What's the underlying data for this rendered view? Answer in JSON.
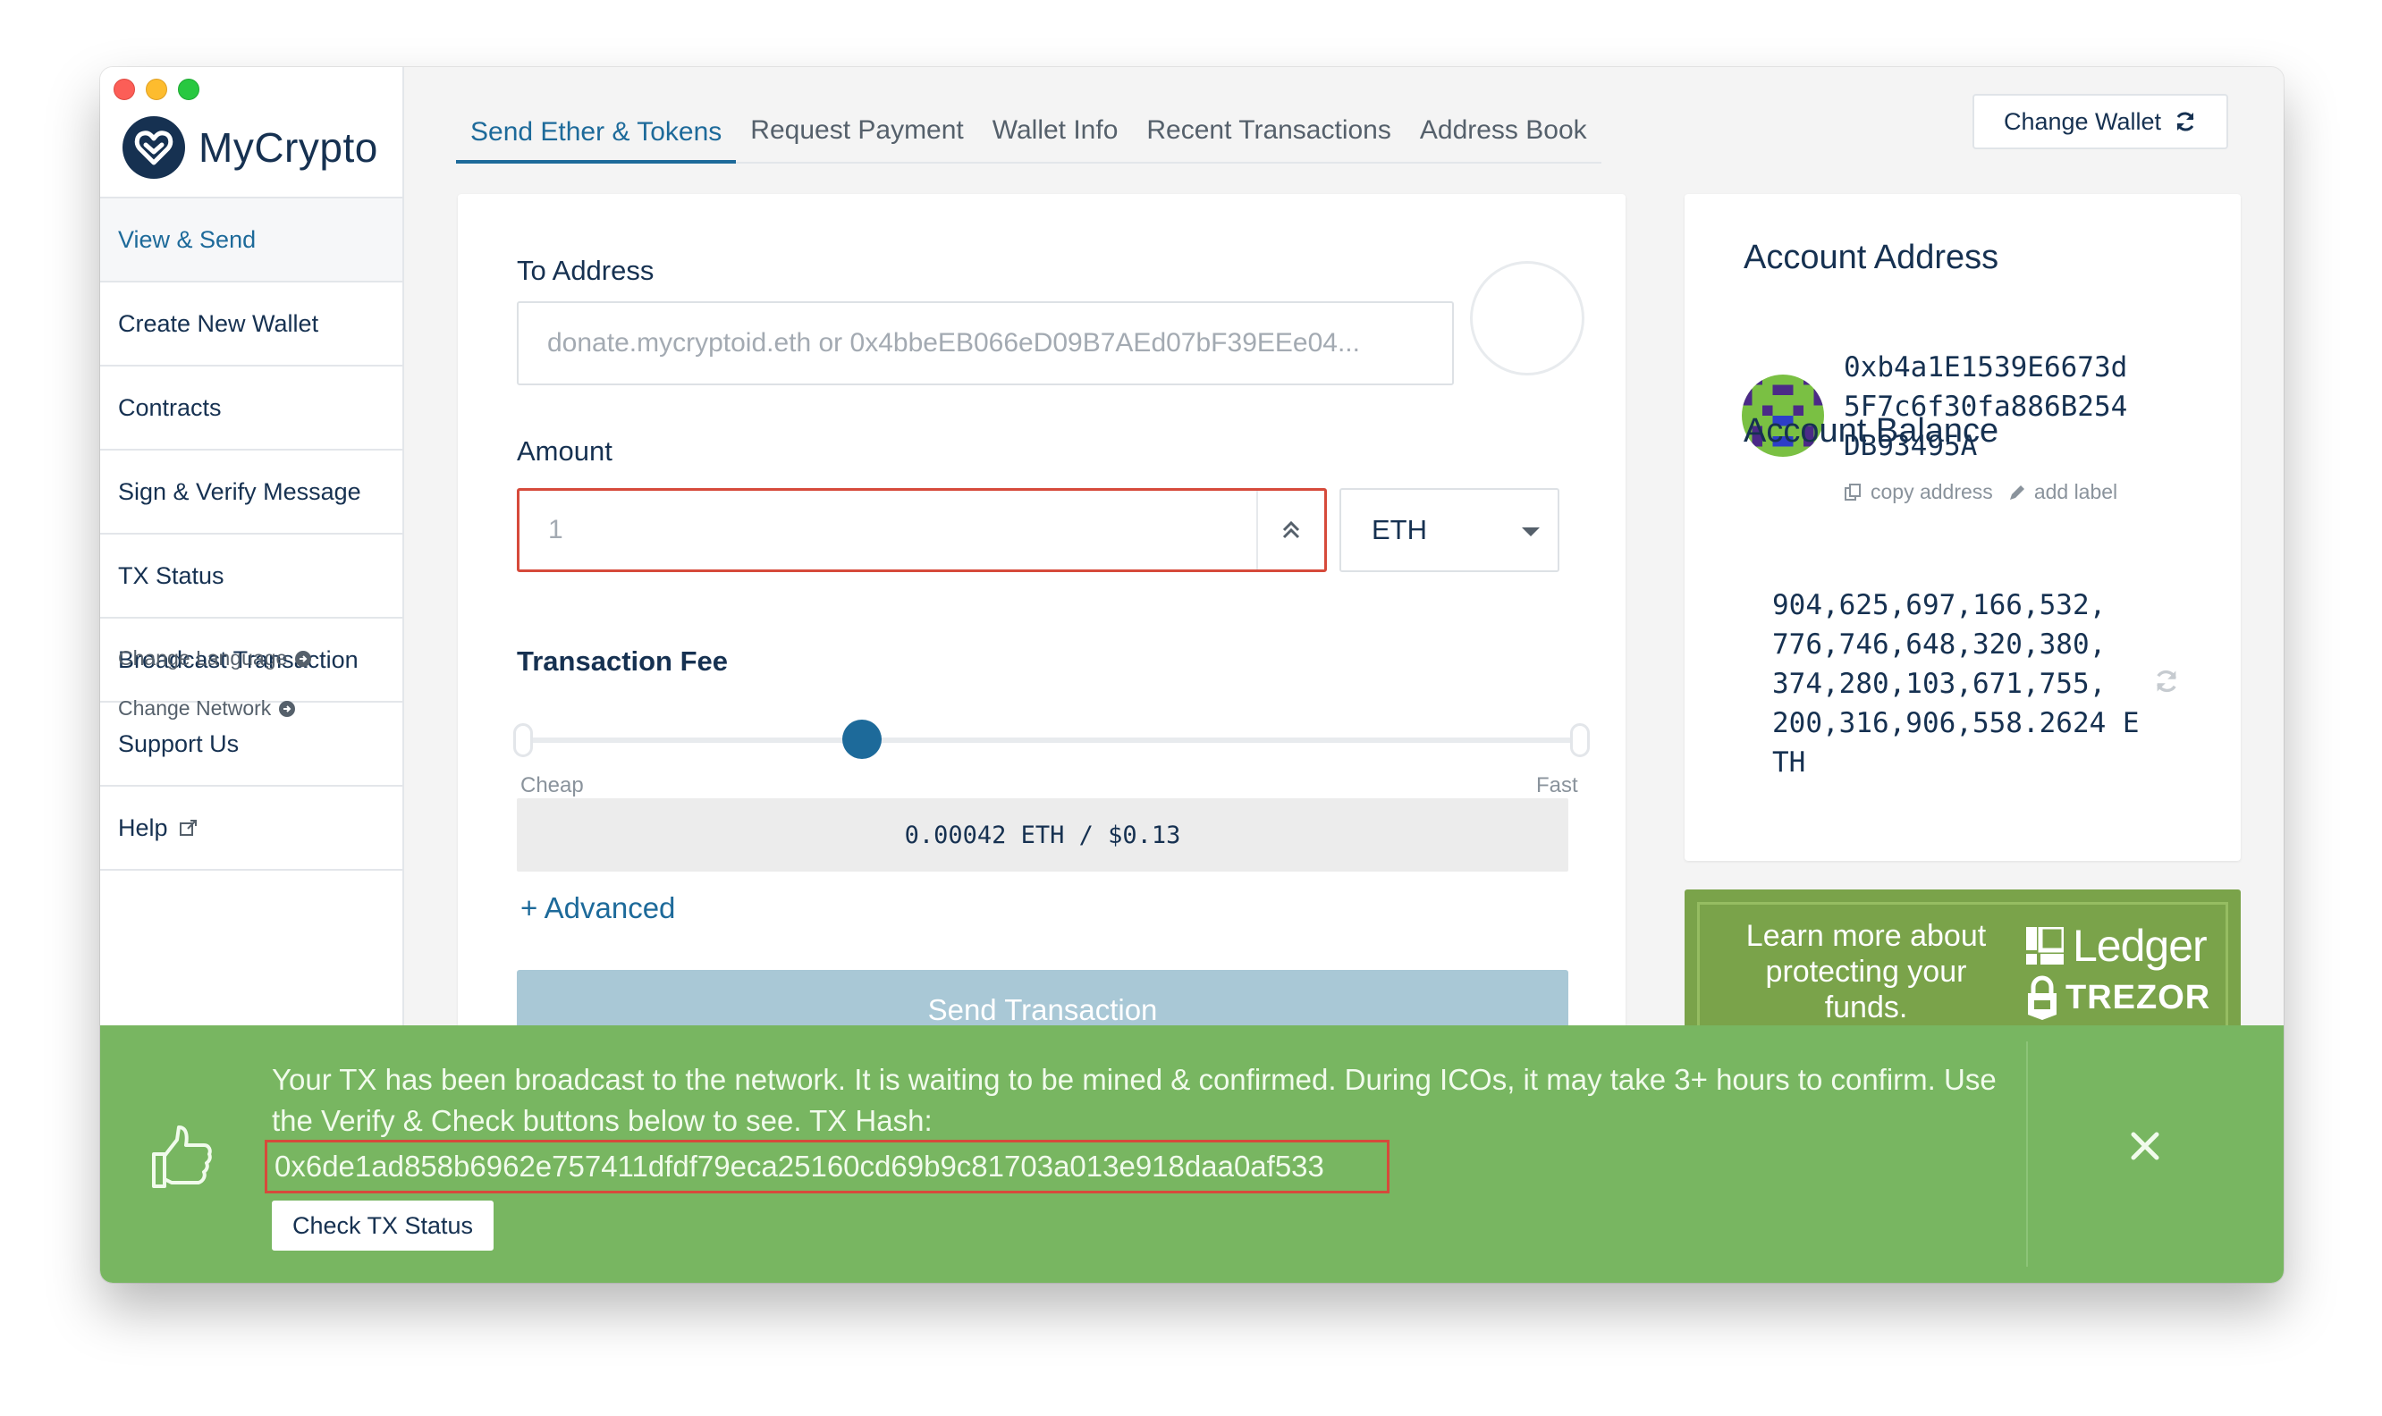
{
  "app": {
    "name": "MyCrypto"
  },
  "sidebar": {
    "items": [
      {
        "label": "View & Send",
        "active": true
      },
      {
        "label": "Create New Wallet"
      },
      {
        "label": "Contracts"
      },
      {
        "label": "Sign & Verify Message"
      },
      {
        "label": "TX Status"
      },
      {
        "label": "Broadcast Transaction"
      },
      {
        "label": "Support Us"
      },
      {
        "label": "Help",
        "icon": "external-link-icon"
      }
    ],
    "change_language": "Change Language",
    "change_network": "Change Network"
  },
  "tabs": [
    {
      "label": "Send Ether & Tokens",
      "active": true
    },
    {
      "label": "Request Payment"
    },
    {
      "label": "Wallet Info"
    },
    {
      "label": "Recent Transactions"
    },
    {
      "label": "Address Book"
    }
  ],
  "header": {
    "change_wallet": "Change Wallet"
  },
  "send": {
    "to_address_label": "To Address",
    "to_address_placeholder": "donate.mycryptoid.eth or 0x4bbeEB066eD09B7AEd07bF39EEe04...",
    "amount_label": "Amount",
    "amount_value": "1",
    "unit": "ETH",
    "fee_label": "Transaction Fee",
    "fee_cheap": "Cheap",
    "fee_fast": "Fast",
    "fee_level": 0.32,
    "fee_display": "0.00042 ETH / $0.13",
    "advanced": "+ Advanced",
    "send_button": "Send Transaction"
  },
  "account": {
    "address_title": "Account Address",
    "address_lines": [
      "0xb4a1E1539E6673d",
      "5F7c6f30fa886B254",
      "DB93495A"
    ],
    "copy_address": "copy address",
    "add_label": "add label",
    "balance_title": "Account Balance",
    "balance_lines": [
      "904,625,697,166,532,",
      "776,746,648,320,380,",
      "374,280,103,671,755,",
      "200,316,906,558.2624 E",
      "TH"
    ]
  },
  "promo": {
    "text": "Learn more about protecting your funds.",
    "ledger": "Ledger",
    "trezor": "TREZOR"
  },
  "notification": {
    "message": "Your TX has been broadcast to the network. It is waiting to be mined & confirmed. During ICOs, it may take 3+ hours to confirm. Use the Verify & Check buttons below to see. TX Hash:",
    "tx_hash": "0x6de1ad858b6962e757411dfdf79eca25160cd69b9c81703a013e918daa0af533",
    "check_button": "Check TX Status"
  },
  "colors": {
    "brand_navy": "#163151",
    "accent_blue": "#1d6a9a",
    "success_green": "#78b661",
    "error_red": "#d64a3b",
    "promo_green": "#7aa34a"
  }
}
